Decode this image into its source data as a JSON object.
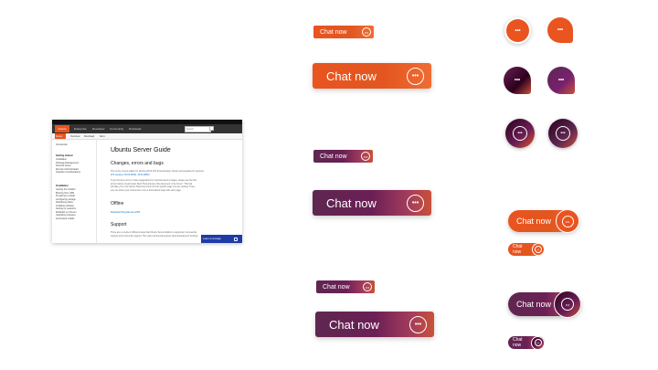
{
  "colors": {
    "orange": "#e95420",
    "purple": "#5e2750",
    "accent_blue": "#1f3ba7"
  },
  "mini_page": {
    "logo": "ubuntu",
    "nav_items": [
      "Enterprise",
      "Developer",
      "Community",
      "Download"
    ],
    "search_placeholder": "Search",
    "subnav_items": [
      "Server",
      "Overview",
      "Download",
      "Docs"
    ],
    "sidebar": {
      "intro": "Introduction",
      "section1": "Getting started",
      "items1": [
        "Installation",
        "Package Management",
        "Network Setup",
        "Remote Administration",
        "Upgrade Considerations"
      ],
      "section2": "Installation",
      "items2": [
        "Getting the installer",
        "Booting from USB",
        "Preparing to install",
        "Configuring storage",
        "Partitioning disks",
        "Installing software",
        "Setting up networks",
        "Multipath on Ubuntu",
        "Upgrading releases",
        "Automated installs"
      ]
    },
    "main": {
      "title": "Ubuntu Server Guide",
      "h2_changes": "Changes, errors and bugs",
      "p1": "This is the current edition for Ubuntu 20.04 LTS (Focal Fossa). Ubuntu serverguides for previous",
      "p1b": "LTS versions: 18.04 (PDF), 16.04 (PDF).",
      "p2": "If you find any errors or have suggestions for improvements to pages, please use the link",
      "p2b": "at the bottom of each topic titled \"Help improve this document in the forum\". This link",
      "p2c": "will take you to the Server Discourse forum for the specific page you are viewing. There",
      "p2d": "you can share your comments or let us know about bugs with each page.",
      "h2_offline": "Offline",
      "offline_link": "Download this guide as a PDF",
      "h2_support": "Support",
      "p3": "There are a couple of different ways that Ubuntu Server Edition is supported: commercial",
      "p3b": "support and community support. The main commercial support (and development funding)"
    },
    "leave_message": "Leave a message"
  },
  "buttons": {
    "chat_label": "Chat now",
    "bubble_glyph": "•••"
  }
}
